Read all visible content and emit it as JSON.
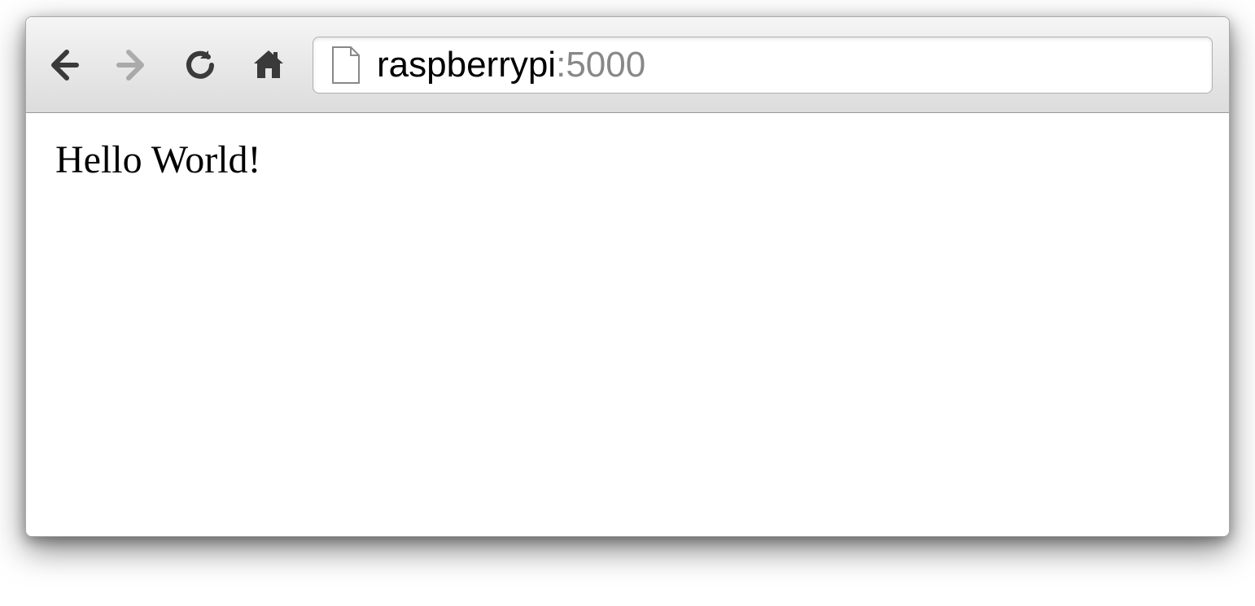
{
  "toolbar": {
    "back_enabled": true,
    "forward_enabled": false
  },
  "address": {
    "host": "raspberrypi",
    "port": ":5000"
  },
  "page": {
    "body_text": "Hello World!"
  }
}
